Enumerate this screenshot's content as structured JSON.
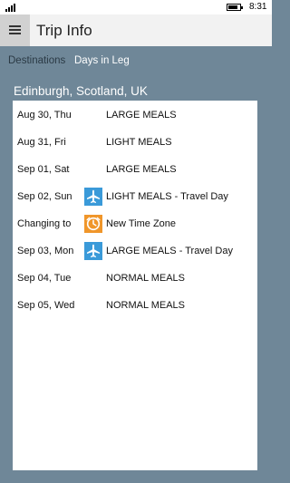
{
  "status_bar": {
    "time": "8:31"
  },
  "header": {
    "title": "Trip Info"
  },
  "tabs": [
    {
      "label": "Destinations"
    },
    {
      "label": "Days in Leg"
    }
  ],
  "location": "Edinburgh, Scotland, UK",
  "days": [
    {
      "date": "Aug 30, Thu",
      "icon": "",
      "status": "LARGE MEALS"
    },
    {
      "date": "Aug 31, Fri",
      "icon": "",
      "status": "LIGHT MEALS"
    },
    {
      "date": "Sep 01, Sat",
      "icon": "",
      "status": "LARGE MEALS"
    },
    {
      "date": "Sep 02, Sun",
      "icon": "airplane-icon",
      "status": "LIGHT MEALS - Travel Day"
    },
    {
      "date": "Changing to",
      "icon": "clock-icon",
      "status": "New Time Zone"
    },
    {
      "date": "Sep 03, Mon",
      "icon": "airplane-icon",
      "status": "LARGE MEALS - Travel Day"
    },
    {
      "date": "Sep 04, Tue",
      "icon": "",
      "status": "NORMAL MEALS"
    },
    {
      "date": "Sep 05, Wed",
      "icon": "",
      "status": "NORMAL MEALS"
    }
  ],
  "colors": {
    "page_background": "#6f8798",
    "travel_icon": "#3a9ad9",
    "time_zone_icon": "#f0962a"
  }
}
